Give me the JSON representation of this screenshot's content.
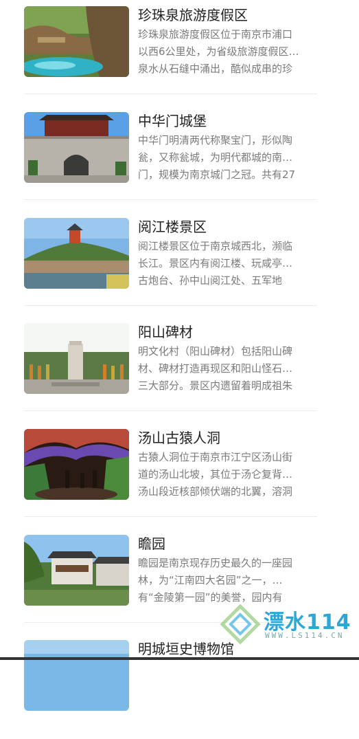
{
  "items": [
    {
      "title": "珍珠泉旅游度假区",
      "lines": [
        "珍珠泉旅游度假区位于南京市浦口",
        "以西6公里处，为省级旅游度假区…",
        "泉水从石缝中涌出，酷似成串的珍"
      ],
      "image": "pearl-spring-photo"
    },
    {
      "title": "中华门城堡",
      "lines": [
        "中华门明清两代称聚宝门，形似陶",
        "瓮，又称瓮城，为明代都城的南…",
        "门，规模为南京城门之冠。共有27"
      ],
      "image": "zhonghua-gate-photo"
    },
    {
      "title": "阅江楼景区",
      "lines": [
        "阅江楼景区位于南京城西北，濒临",
        "长江。景区内有阅江楼、玩咸亭…",
        "古炮台、孙中山阅江处、五军地"
      ],
      "image": "yuejiang-tower-photo"
    },
    {
      "title": "阳山碑材",
      "lines": [
        "明文化村（阳山碑材）包括阳山碑",
        "材、碑材打造再现区和阳山怪石…",
        "三大部分。景区内遗留着明成祖朱"
      ],
      "image": "yangshan-stele-photo"
    },
    {
      "title": "汤山古猿人洞",
      "lines": [
        "古猿人洞位于南京市江宁区汤山街",
        "道的汤山北坡，其位于汤仑复背…",
        "汤山段近核部倾伏端的北翼，溶洞"
      ],
      "image": "tangshan-cave-photo"
    },
    {
      "title": "瞻园",
      "lines": [
        "瞻园是南京现存历史最久的一座园",
        "林，为“江南四大名园”之一，…",
        "有“金陵第一园”的美誉，园内有"
      ],
      "image": "zhanyuan-garden-photo"
    },
    {
      "title": "明城垣史博物馆",
      "lines": [],
      "image": "city-wall-museum-photo"
    }
  ],
  "watermark": {
    "brand": "漂水114",
    "url": "WWW.LS114.CN",
    "logo": "diamond-logo-icon"
  }
}
